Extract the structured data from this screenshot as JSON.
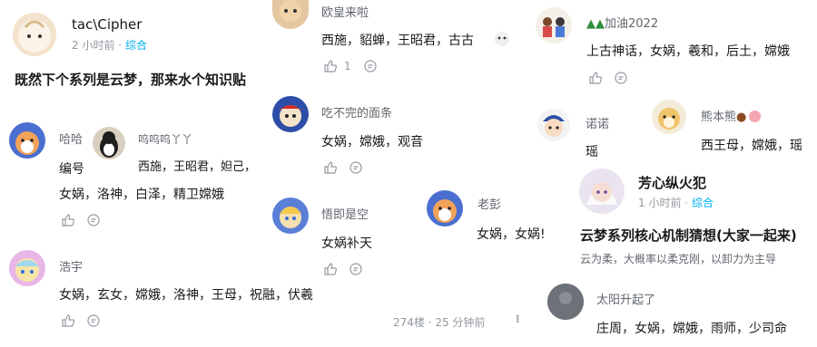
{
  "post": {
    "author": "tac\\Cipher",
    "time": "2 小时前",
    "sep": "·",
    "topic": "综合",
    "title": "既然下个系列是云梦，那来水个知识贴"
  },
  "comments": {
    "haha": {
      "name": "哈哈",
      "text": "编号"
    },
    "haha_line2": "女娲，洛神，白泽，精卫嫦娥",
    "wuwu": {
      "name": "呜呜呜丫丫",
      "text": "西施，王昭君，妲己，"
    },
    "haoyu": {
      "name": "浩宇",
      "text": "女娲，玄女，嫦娥，洛神，王母，祝融，伏羲"
    },
    "ouhuang": {
      "name": "欧皇来啦",
      "text": "西施，貂蝉，王昭君，古古",
      "likes": "1"
    },
    "chibuwan": {
      "name": "吃不完的面条",
      "text": "女娲，嫦娥，观音"
    },
    "wuji": {
      "name": "悟即是空",
      "text": "女娲补天"
    },
    "laopeng": {
      "name": "老彭",
      "text": "女娲，女娲!"
    },
    "jiayou": {
      "name": "加油2022",
      "text": "上古神话，女娲，羲和，后土，嫦娥"
    },
    "nuonuo": {
      "name": "诺诺",
      "text": "瑶"
    },
    "xiongben": {
      "name": "熊本熊",
      "text": "西王母，嫦娥，瑶"
    },
    "taiyang": {
      "name": "太阳升起了",
      "text": "庄周，女娲，嫦娥，雨师，少司命"
    }
  },
  "footer": {
    "floor": "274楼 · 25 分钟前",
    "more": "⁝"
  },
  "post2": {
    "author": "芳心纵火犯",
    "time": "1 小时前",
    "sep": "·",
    "topic": "综合",
    "title": "云梦系列核心机制猜想(大家一起来)",
    "preview": "云为柔，大概率以柔克刚，以卸力为主导"
  },
  "icons": {
    "like": "thumb-up-icon",
    "reply": "reply-icon"
  },
  "colors": {
    "topic": "#00aeec",
    "meta": "#9499a0"
  }
}
